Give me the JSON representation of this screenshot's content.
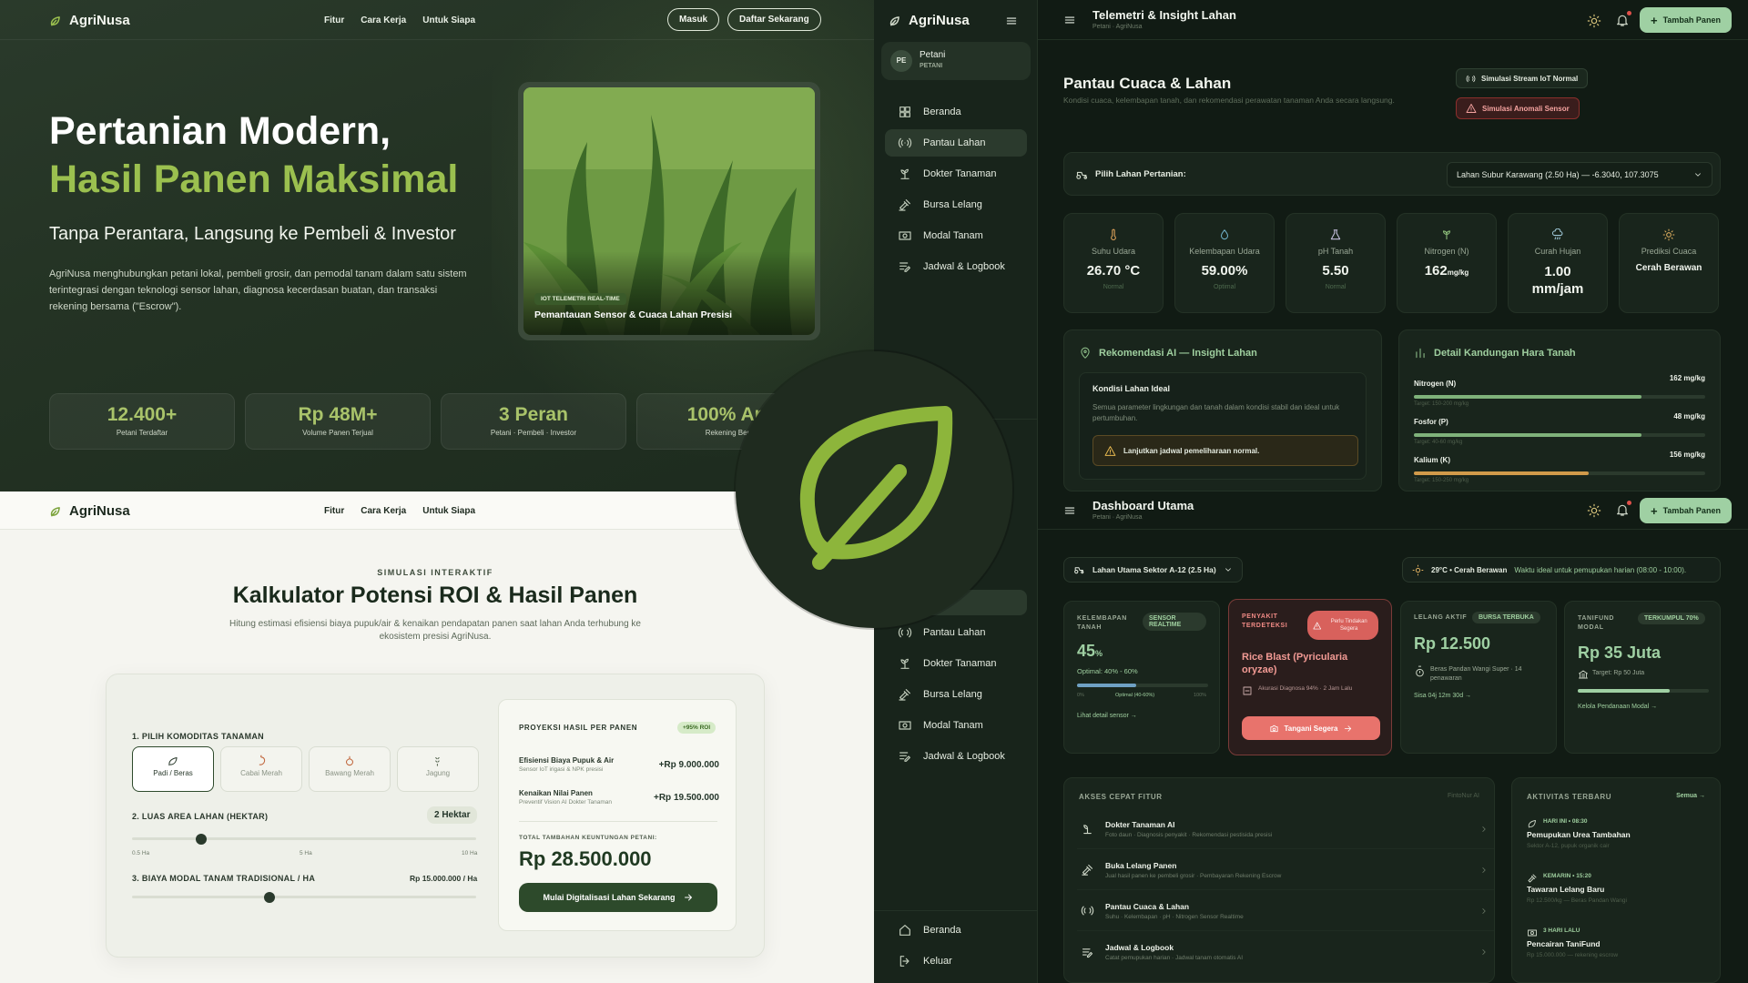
{
  "brand": "AgriNusa",
  "hero": {
    "nav": {
      "links": [
        "Fitur",
        "Cara Kerja",
        "Untuk Siapa"
      ],
      "login": "Masuk",
      "signup": "Daftar Sekarang"
    },
    "title_line1": "Pertanian Modern,",
    "title_line2": "Hasil Panen Maksimal",
    "subtitle": "Tanpa Perantara, Langsung ke Pembeli & Investor",
    "description": "AgriNusa menghubungkan petani lokal, pembeli grosir, dan pemodal tanam dalam satu sistem terintegrasi dengan teknologi sensor lahan, diagnosa kecerdasan buatan, dan transaksi rekening bersama (\"Escrow\").",
    "image_badge": "IOT TELEMETRI REAL-TIME",
    "image_caption": "Pemantauan Sensor & Cuaca Lahan Presisi",
    "stats": [
      {
        "value": "12.400+",
        "label": "Petani Terdaftar"
      },
      {
        "value": "Rp 48M+",
        "label": "Volume Panen Terjual"
      },
      {
        "value": "3 Peran",
        "label": "Petani · Pembeli · Investor"
      },
      {
        "value": "100% Am",
        "label": "Rekening Bers"
      }
    ]
  },
  "calc": {
    "nav": {
      "links": [
        "Fitur",
        "Cara Kerja",
        "Untuk Siapa"
      ]
    },
    "kicker": "SIMULASI INTERAKTIF",
    "title": "Kalkulator Potensi ROI & Hasil Panen",
    "description": "Hitung estimasi efisiensi biaya pupuk/air & kenaikan pendapatan panen saat lahan Anda terhubung ke ekosistem presisi AgriNusa.",
    "step1": "1. PILIH KOMODITAS TANAMAN",
    "crops": [
      "Padi / Beras",
      "Cabai Merah",
      "Bawang Merah",
      "Jagung"
    ],
    "step2": "2. LUAS AREA LAHAN (HEKTAR)",
    "area_value": "2 Hektar",
    "area_ticks": [
      "0.5 Ha",
      "5 Ha",
      "10 Ha"
    ],
    "area_fraction": 0.2,
    "step3": "3. BIAYA MODAL TANAM TRADISIONAL / HA",
    "cost_value": "Rp 15.000.000 / Ha",
    "cost_fraction": 0.4,
    "projection": {
      "title": "PROYEKSI HASIL PER PANEN",
      "badge": "+95% ROI",
      "rows": [
        {
          "title": "Efisiensi Biaya Pupuk & Air",
          "sub": "Sensor IoT irigasi & NPK presisi",
          "value": "+Rp 9.000.000"
        },
        {
          "title": "Kenaikan Nilai Panen",
          "sub": "Preventif Vision AI Dokter Tanaman",
          "value": "+Rp 19.500.000"
        }
      ],
      "total_label": "TOTAL TAMBAHAN KEUNTUNGAN PETANI:",
      "total_value": "Rp 28.500.000",
      "cta": "Mulai Digitalisasi Lahan Sekarang"
    }
  },
  "sidebar": {
    "brand": "AgriNusa",
    "user_initials": "PE",
    "user_name": "Petani",
    "user_role": "PETANI",
    "items": [
      "Beranda",
      "Pantau Lahan",
      "Dokter Tanaman",
      "Bursa Lelang",
      "Modal Tanam",
      "Jadwal & Logbook"
    ],
    "items2": [
      "Pantau Lahan",
      "Dokter Tanaman",
      "Bursa Lelang",
      "Modal Tanam",
      "Jadwal & Logbook"
    ],
    "footer": [
      "Beranda",
      "Keluar"
    ]
  },
  "tele": {
    "title": "Telemetri & Insight Lahan",
    "breadcrumb": "Petani · AgriNusa",
    "add_button": "Tambah Panen",
    "heading": "Pantau Cuaca & Lahan",
    "heading_sub": "Kondisi cuaca, kelembapan tanah, dan rekomendasi perawatan tanaman Anda secara langsung.",
    "sim_normal": "Simulasi Stream IoT Normal",
    "sim_anomaly": "Simulasi Anomali Sensor",
    "select_label": "Pilih Lahan Pertanian:",
    "select_value": "Lahan Subur Karawang (2.50 Ha) — -6.3040, 107.3075",
    "metrics": [
      {
        "title": "Suhu Udara",
        "value": "26.70 °C",
        "status": "Normal",
        "icon": "thermometer-icon"
      },
      {
        "title": "Kelembapan Udara",
        "value": "59.00%",
        "status": "Optimal",
        "icon": "droplet-icon"
      },
      {
        "title": "pH Tanah",
        "value": "5.50",
        "status": "Normal",
        "icon": "flask-icon"
      },
      {
        "title": "Nitrogen (N)",
        "value": "162",
        "unit": "mg/kg",
        "icon": "sprout-icon"
      },
      {
        "title": "Curah Hujan",
        "value": "1.00 mm/jam",
        "icon": "rain-icon"
      },
      {
        "title": "Prediksi Cuaca",
        "value": "Cerah Berawan",
        "icon": "sun-icon"
      }
    ],
    "ai": {
      "title": "Rekomendasi AI — Insight Lahan",
      "box_title": "Kondisi Lahan Ideal",
      "box_text": "Semua parameter lingkungan dan tanah dalam kondisi stabil dan ideal untuk pertumbuhan.",
      "alert": "Lanjutkan jadwal pemeliharaan normal."
    },
    "nutrients": {
      "title": "Detail Kandungan Hara Tanah",
      "items": [
        {
          "name": "Nitrogen (N)",
          "value": "162 mg/kg",
          "target": "Target: 150-200 mg/kg",
          "fraction": 0.78,
          "color": "#7fb27a"
        },
        {
          "name": "Fosfor (P)",
          "value": "48 mg/kg",
          "target": "Target: 40-60 mg/kg",
          "fraction": 0.78,
          "color": "#7fb27a"
        },
        {
          "name": "Kalium (K)",
          "value": "156 mg/kg",
          "target": "Target: 150-250 mg/kg",
          "fraction": 0.6,
          "color": "#d19a4a"
        }
      ]
    }
  },
  "dash": {
    "title": "Dashboard Utama",
    "breadcrumb": "Petani · AgriNusa",
    "add_button": "Tambah Panen",
    "land_select": "Lahan Utama Sektor A-12 (2.5 Ha)",
    "weather": "29°C • Cerah Berawan",
    "weather_note": "Waktu ideal untuk pemupukan harian (08:00 - 10:00).",
    "moisture": {
      "title": "KELEMBAPAN TANAH",
      "tag": "SENSOR REALTIME",
      "value": "45",
      "unit": "%",
      "optimal": "Optimal: 40% - 60%",
      "scale": [
        "0%",
        "Optimal (40-60%)",
        "100%"
      ],
      "fraction": 0.45,
      "link": "Lihat detail sensor →"
    },
    "disease": {
      "title": "PENYAKIT TERDETEKSI",
      "tag": "Perlu Tindakan Segera",
      "name": "Rice Blast (Pyricularia oryzae)",
      "meta": "Akurasi Diagnosa 94% · 2 Jam Lalu",
      "cta": "Tangani Segera"
    },
    "auction": {
      "title": "LELANG AKTIF",
      "tag": "BURSA TERBUKA",
      "value": "Rp 12.500",
      "meta": "Beras Pandan Wangi Super · 14 penawaran",
      "link": "Sisa 04j 12m 30d →"
    },
    "fund": {
      "title": "TANIFUND MODAL",
      "tag": "TERKUMPUL 70%",
      "value": "Rp 35 Juta",
      "meta": "Target: Rp 50 Juta",
      "fraction": 0.7,
      "link": "Kelola Pendanaan Modal →"
    },
    "quick": {
      "title": "AKSES CEPAT FITUR",
      "note": "FintoNur AI",
      "items": [
        {
          "title": "Dokter Tanaman AI",
          "sub": "Foto daun · Diagnosis penyakit · Rekomendasi pestisida presisi"
        },
        {
          "title": "Buka Lelang Panen",
          "sub": "Jual hasil panen ke pembeli grosir · Pembayaran Rekening Escrow"
        },
        {
          "title": "Pantau Cuaca & Lahan",
          "sub": "Suhu · Kelembapan · pH · Nitrogen Sensor Realtime"
        },
        {
          "title": "Jadwal & Logbook",
          "sub": "Catat pemupukan harian · Jadwal tanam otomatis AI"
        }
      ]
    },
    "activity": {
      "title": "AKTIVITAS TERBARU",
      "all": "Semua →",
      "items": [
        {
          "time": "HARI INI • 08:30",
          "title": "Pemupukan Urea Tambahan",
          "sub": "Sektor A-12, pupuk organik cair"
        },
        {
          "time": "KEMARIN • 15:20",
          "title": "Tawaran Lelang Baru",
          "sub": "Rp 12.500/kg — Beras Pandan Wangi"
        },
        {
          "time": "3 HARI LALU",
          "title": "Pencairan TaniFund",
          "sub": "Rp 15.000.000 — rekening escrow"
        }
      ]
    }
  },
  "colors": {
    "accent": "#9bc04f",
    "dark_green": "#2d4a2b",
    "panel": "#19251c",
    "danger": "#e0504a",
    "mint": "#9fd0a3"
  }
}
